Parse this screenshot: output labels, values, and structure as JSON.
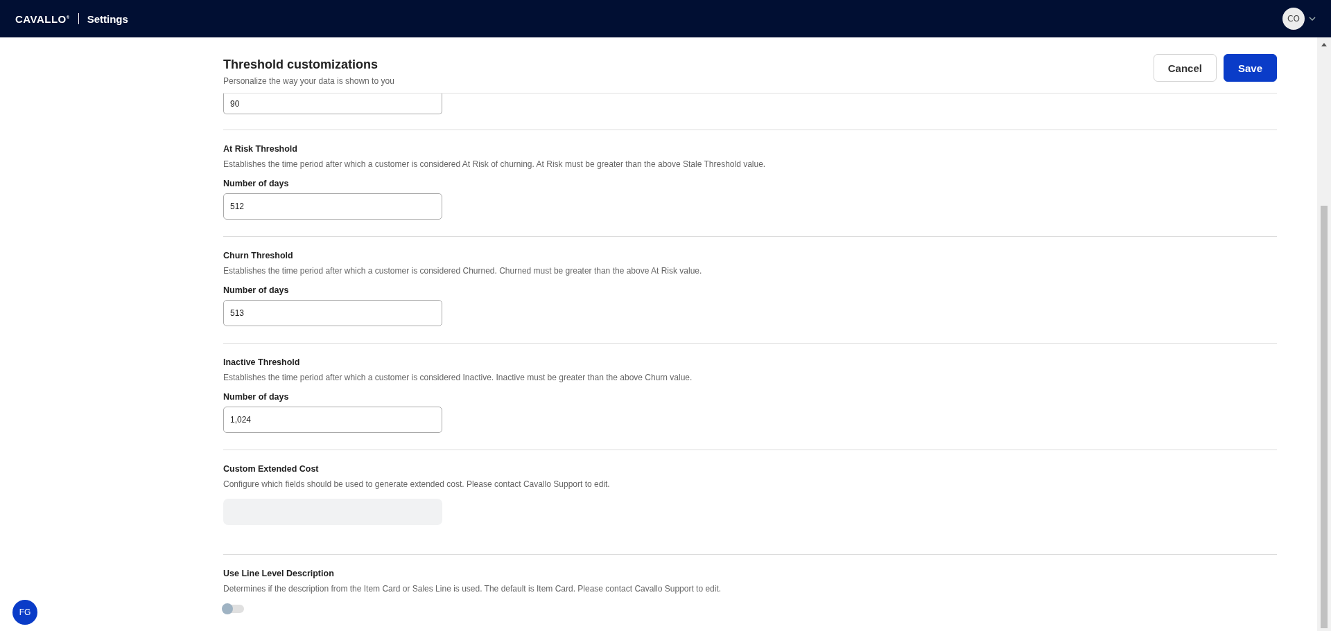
{
  "header": {
    "logo": "CAVALLO",
    "logo_mark": "®",
    "title": "Settings",
    "user_initials": "CO"
  },
  "page": {
    "title": "Threshold customizations",
    "subtitle": "Personalize the way your data is shown to you",
    "buttons": [
      {
        "label": "Cancel",
        "kind": "secondary"
      },
      {
        "label": "Save",
        "kind": "primary"
      }
    ]
  },
  "sections": [
    {
      "kind": "partial",
      "value": "90"
    },
    {
      "kind": "number",
      "title": "At Risk Threshold",
      "description": "Establishes the time period after which a customer is considered At Risk of churning. At Risk must be greater than the above Stale Threshold value.",
      "field_label": "Number of days",
      "value": "512"
    },
    {
      "kind": "number",
      "title": "Churn Threshold",
      "description": "Establishes the time period after which a customer is considered Churned. Churned must be greater than the above At Risk value.",
      "field_label": "Number of days",
      "value": "513"
    },
    {
      "kind": "number",
      "title": "Inactive Threshold",
      "description": "Establishes the time period after which a customer is considered Inactive. Inactive must be greater than the above Churn value.",
      "field_label": "Number of days",
      "value": "1,024"
    },
    {
      "kind": "disabled",
      "title": "Custom Extended Cost",
      "description": "Configure which fields should be used to generate extended cost. Please contact Cavallo Support to edit."
    },
    {
      "kind": "toggle",
      "title": "Use Line Level Description",
      "description": "Determines if the description from the Item Card or Sales Line is used. The default is Item Card. Please contact Cavallo Support to edit.",
      "on": false
    }
  ],
  "floating_avatar": "FG"
}
